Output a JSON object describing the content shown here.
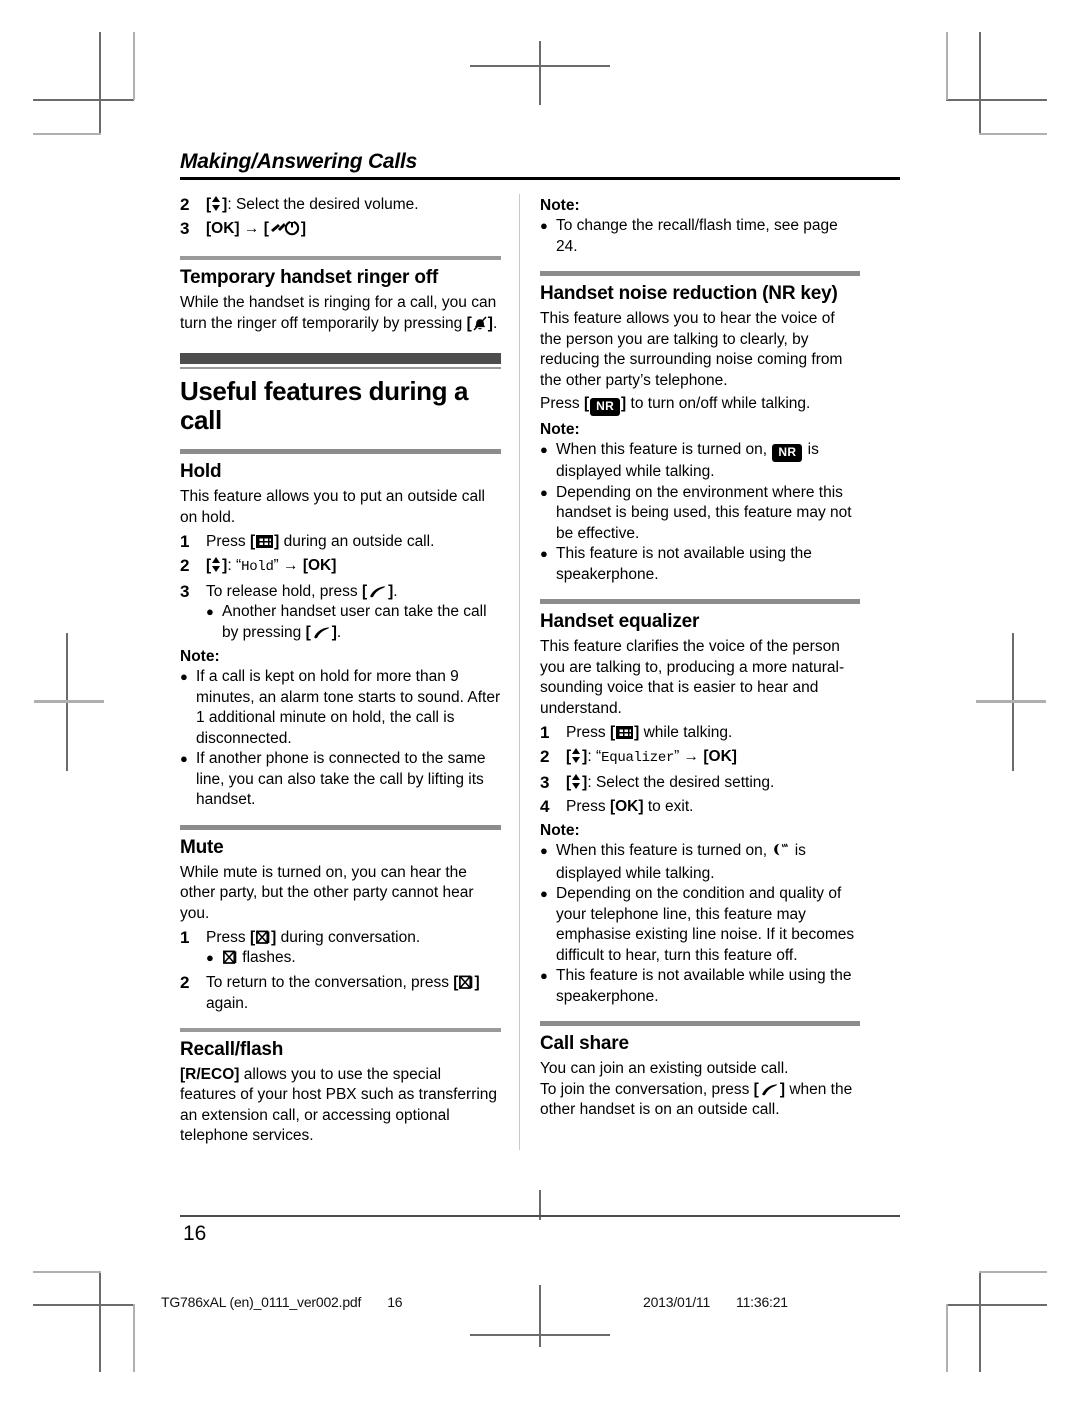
{
  "document": {
    "chapter_title": "Making/Answering Calls",
    "page_number": "16"
  },
  "left_column": {
    "continued_steps": [
      {
        "num": "2",
        "text": ": Select the desired volume."
      },
      {
        "num": "3",
        "text": ""
      }
    ],
    "step2_key": "[ ]",
    "step3_ok": "[OK]",
    "step3_arrow": "→",
    "ringer_off": {
      "heading": "Temporary handset ringer off",
      "body_part1": "While the handset is ringing for a call, you can turn the ringer off temporarily by pressing ",
      "body_part2": "."
    },
    "section_title": "Useful features during a call",
    "hold": {
      "heading": "Hold",
      "intro": "This feature allows you to put an outside call on hold.",
      "step1_pre": "Press ",
      "step1_post": " during an outside call.",
      "step2_quote_open": "“",
      "step2_menu": "Hold",
      "step2_quote_close": "”",
      "step2_arrow": "→",
      "step2_ok": "[OK]",
      "step3_pre": "To release hold, press ",
      "step3_post": ".",
      "step3_bullet_pre": "Another handset user can take the call by pressing ",
      "step3_bullet_post": ".",
      "note_label": "Note:",
      "notes": [
        "If a call is kept on hold for more than 9 minutes, an alarm tone starts to sound. After 1 additional minute on hold, the call is disconnected.",
        "If another phone is connected to the same line, you can also take the call by lifting its handset."
      ]
    },
    "mute": {
      "heading": "Mute",
      "intro": "While mute is turned on, you can hear the other party, but the other party cannot hear you.",
      "step1_pre": "Press ",
      "step1_post": " during conversation.",
      "step1_bullet_post": " flashes.",
      "step2_pre": "To return to the conversation, press ",
      "step2_post": " again."
    },
    "recall": {
      "heading": "Recall/flash",
      "key_label": "[R/ECO]",
      "body": " allows you to use the special features of your host PBX such as transferring an extension call, or accessing optional telephone services."
    }
  },
  "right_column": {
    "recall_note": {
      "note_label": "Note:",
      "notes": [
        "To change the recall/flash time, see page 24."
      ]
    },
    "noise_reduction": {
      "heading": "Handset noise reduction (NR key)",
      "intro": "This feature allows you to hear the voice of the person you are talking to clearly, by reducing the surrounding noise coming from the other party’s telephone.",
      "press_pre": "Press ",
      "press_post": " to turn on/off while talking.",
      "note_label": "Note:",
      "note1_pre": "When this feature is turned on, ",
      "note1_post": " is displayed while talking.",
      "notes": [
        "Depending on the environment where this handset is being used, this feature may not be effective.",
        "This feature is not available using the speakerphone."
      ]
    },
    "equalizer": {
      "heading": "Handset equalizer",
      "intro": "This feature clarifies the voice of the person you are talking to, producing a more natural-sounding voice that is easier to hear and understand.",
      "step1_pre": "Press ",
      "step1_post": " while talking.",
      "step2_quote_open": "“",
      "step2_menu": "Equalizer",
      "step2_quote_close": "”",
      "step2_arrow": "→",
      "step2_ok": "[OK]",
      "step3_text": ": Select the desired setting.",
      "step4_pre": "Press ",
      "step4_ok": "[OK]",
      "step4_post": " to exit.",
      "note_label": "Note:",
      "note1_pre": "When this feature is turned on, ",
      "note1_post": " is displayed while talking.",
      "notes": [
        "Depending on the condition and quality of your telephone line, this feature may emphasise existing line noise. If it becomes difficult to hear, turn this feature off.",
        "This feature is not available while using the speakerphone."
      ]
    },
    "call_share": {
      "heading": "Call share",
      "line1": "You can join an existing outside call.",
      "line2_pre": "To join the conversation, press ",
      "line2_post": " when the other handset is on an outside call."
    }
  },
  "icons": {
    "nr_badge": "NR",
    "nav_key": "navigator-up-down-key",
    "menu_key": "menu-keypad-key",
    "talk_key": "talk-handset-key",
    "mute_key": "mute-key",
    "power_off_key": "power-off-key",
    "ringer_off_key": "ringer-off-key",
    "equalizer_indicator": "equalizer-indicator"
  },
  "footer": {
    "file_name": "TG786xAL (en)_0111_ver002.pdf",
    "file_page": "16",
    "date": "2013/01/11",
    "time": "11:36:21"
  }
}
